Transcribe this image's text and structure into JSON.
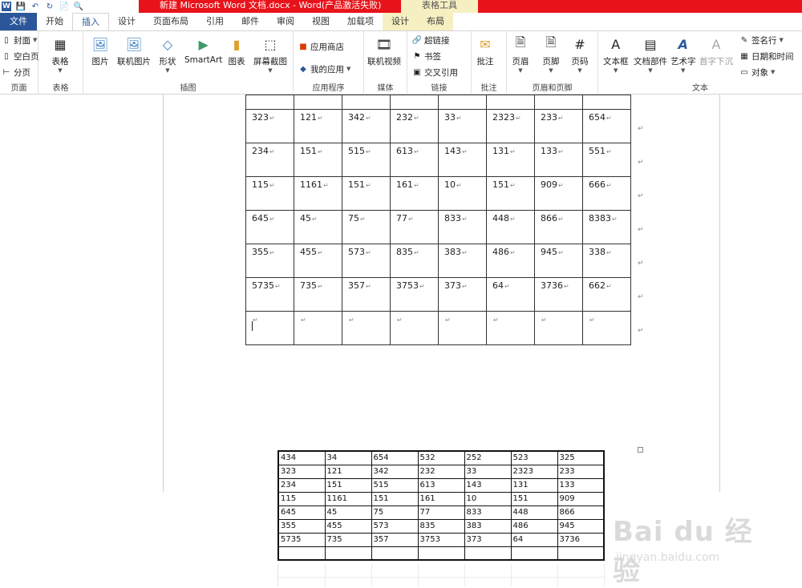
{
  "titlebar": {
    "title": "新建 Microsoft Word 文档.docx - Word(产品激活失败)",
    "context_tools": "表格工具",
    "qat": [
      "W",
      "💾",
      "↶",
      "↻",
      "📄",
      "🔍"
    ]
  },
  "tabs": [
    {
      "label": "文件",
      "kind": "file"
    },
    {
      "label": "开始",
      "kind": "normal"
    },
    {
      "label": "插入",
      "kind": "active"
    },
    {
      "label": "设计",
      "kind": "normal"
    },
    {
      "label": "页面布局",
      "kind": "normal"
    },
    {
      "label": "引用",
      "kind": "normal"
    },
    {
      "label": "邮件",
      "kind": "normal"
    },
    {
      "label": "审阅",
      "kind": "normal"
    },
    {
      "label": "视图",
      "kind": "normal"
    },
    {
      "label": "加载项",
      "kind": "normal"
    },
    {
      "label": "设计",
      "kind": "ctx"
    },
    {
      "label": "布局",
      "kind": "ctx"
    }
  ],
  "ribbon": {
    "pages": {
      "label": "页面",
      "cover": "封面",
      "blank": "空白页",
      "break": "分页"
    },
    "tables": {
      "label": "表格",
      "table": "表格"
    },
    "illustrations": {
      "label": "插图",
      "picture": "图片",
      "online_picture": "联机图片",
      "shapes": "形状",
      "smartart": "SmartArt",
      "chart": "图表",
      "screenshot": "屏幕截图"
    },
    "apps": {
      "label": "应用程序",
      "store": "应用商店",
      "my_apps": "我的应用"
    },
    "media": {
      "label": "媒体",
      "online_video": "联机视频"
    },
    "links": {
      "label": "链接",
      "hyperlink": "超链接",
      "bookmark": "书签",
      "cross_ref": "交叉引用"
    },
    "comments": {
      "label": "批注",
      "comment": "批注"
    },
    "header_footer": {
      "label": "页眉和页脚",
      "header": "页眉",
      "footer": "页脚",
      "page_number": "页码"
    },
    "text": {
      "label": "文本",
      "textbox": "文本框",
      "quick_parts": "文档部件",
      "wordart": "艺术字",
      "dropcap": "首字下沉",
      "signature": "签名行",
      "datetime": "日期和时间",
      "object": "对象"
    }
  },
  "table1": {
    "rows": [
      [
        "",
        "",
        "",
        "",
        "",
        "",
        "",
        ""
      ],
      [
        "323",
        "121",
        "342",
        "232",
        "33",
        "2323",
        "233",
        "654"
      ],
      [
        "234",
        "151",
        "515",
        "613",
        "143",
        "131",
        "133",
        "551"
      ],
      [
        "115",
        "1161",
        "151",
        "161",
        "10",
        "151",
        "909",
        "666"
      ],
      [
        "645",
        "45",
        "75",
        "77",
        "833",
        "448",
        "866",
        "8383"
      ],
      [
        "355",
        "455",
        "573",
        "835",
        "383",
        "486",
        "945",
        "338"
      ],
      [
        "5735",
        "735",
        "357",
        "3753",
        "373",
        "64",
        "3736",
        "662"
      ],
      [
        "",
        "",
        "",
        "",
        "",
        "",
        "",
        ""
      ]
    ],
    "cell_mark": "↵",
    "row_mark": "↵"
  },
  "table2": {
    "rows": [
      [
        "434",
        "34",
        "654",
        "532",
        "252",
        "523",
        "325"
      ],
      [
        "323",
        "121",
        "342",
        "232",
        "33",
        "2323",
        "233"
      ],
      [
        "234",
        "151",
        "515",
        "613",
        "143",
        "131",
        "133"
      ],
      [
        "115",
        "1161",
        "151",
        "161",
        "10",
        "151",
        "909"
      ],
      [
        "645",
        "45",
        "75",
        "77",
        "833",
        "448",
        "866"
      ],
      [
        "355",
        "455",
        "573",
        "835",
        "383",
        "486",
        "945"
      ],
      [
        "5735",
        "735",
        "357",
        "3753",
        "373",
        "64",
        "3736"
      ],
      [
        "",
        "",
        "",
        "",
        "",
        "",
        ""
      ]
    ]
  },
  "watermark": {
    "brand": "Bai du 经验",
    "url": "jingyan.baidu.com"
  }
}
